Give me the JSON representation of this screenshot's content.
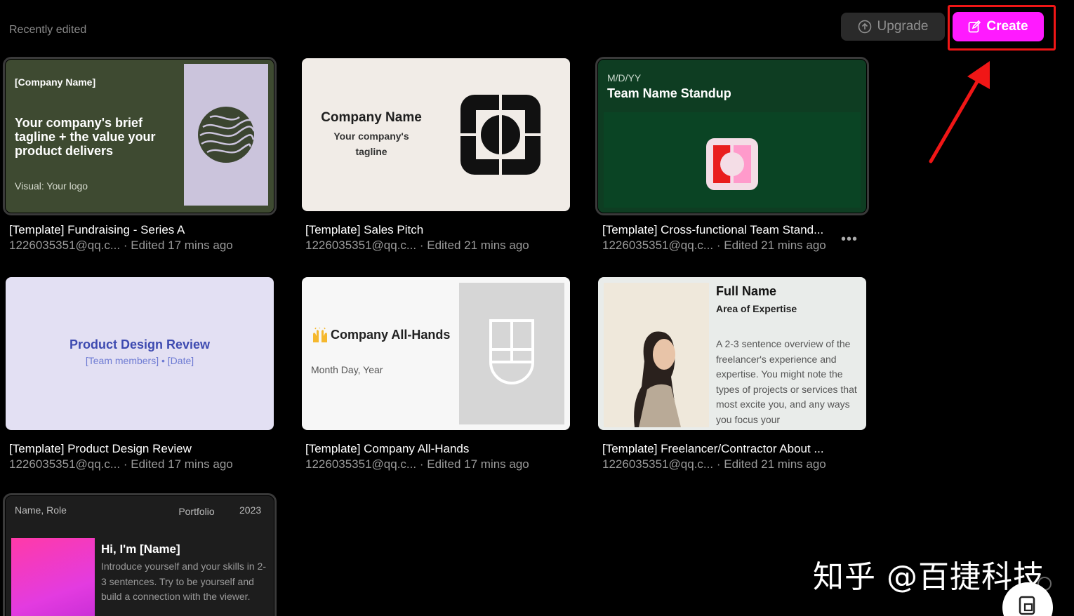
{
  "header": {
    "section_title": "Recently edited",
    "upgrade_label": "Upgrade",
    "create_label": "Create"
  },
  "colors": {
    "background": "#000000",
    "create_button": "#ff1aff",
    "upgrade_button": "#2a2a2a",
    "highlight_annotation": "#f01616"
  },
  "cards": [
    {
      "title": "[Template] Fundraising - Series A",
      "owner": "1226035351@qq.c...",
      "edited": "· Edited 17 mins ago",
      "preview": {
        "company": "[Company Name]",
        "tagline": "Your company's brief tagline + the value your product delivers",
        "visual": "Visual: Your logo"
      }
    },
    {
      "title": "[Template] Sales Pitch",
      "owner": "1226035351@qq.c...",
      "edited": "· Edited 21 mins ago",
      "preview": {
        "company": "Company Name",
        "tagline": "Your company's tagline"
      }
    },
    {
      "title": "[Template] Cross-functional Team Stand...",
      "owner": "1226035351@qq.c...",
      "edited": "· Edited 21 mins ago",
      "more": "•••",
      "preview": {
        "date": "M/D/YY",
        "heading": "Team Name Standup"
      }
    },
    {
      "title": "[Template] Product Design Review",
      "owner": "1226035351@qq.c...",
      "edited": "· Edited 17 mins ago",
      "preview": {
        "heading": "Product Design Review",
        "sub": "[Team members] • [Date]"
      }
    },
    {
      "title": "[Template] Company All-Hands",
      "owner": "1226035351@qq.c...",
      "edited": "· Edited 17 mins ago",
      "preview": {
        "heading": "Company All-Hands",
        "date": "Month Day, Year"
      }
    },
    {
      "title": "[Template] Freelancer/Contractor About ...",
      "owner": "1226035351@qq.c...",
      "edited": "· Edited 21 mins ago",
      "preview": {
        "name": "Full Name",
        "area": "Area of Expertise",
        "overview": "A 2-3 sentence overview of the freelancer's experience and expertise. You might note the types of projects or services that most excite you, and any ways you focus your"
      }
    },
    {
      "preview": {
        "name_role": "Name, Role",
        "portfolio": "Portfolio",
        "year": "2023",
        "greeting": "Hi, I'm [Name]",
        "intro": "Introduce yourself and your skills in 2-3 sentences. Try to be yourself and build a connection with the viewer."
      }
    }
  ],
  "watermark": "知乎 @百捷科技"
}
